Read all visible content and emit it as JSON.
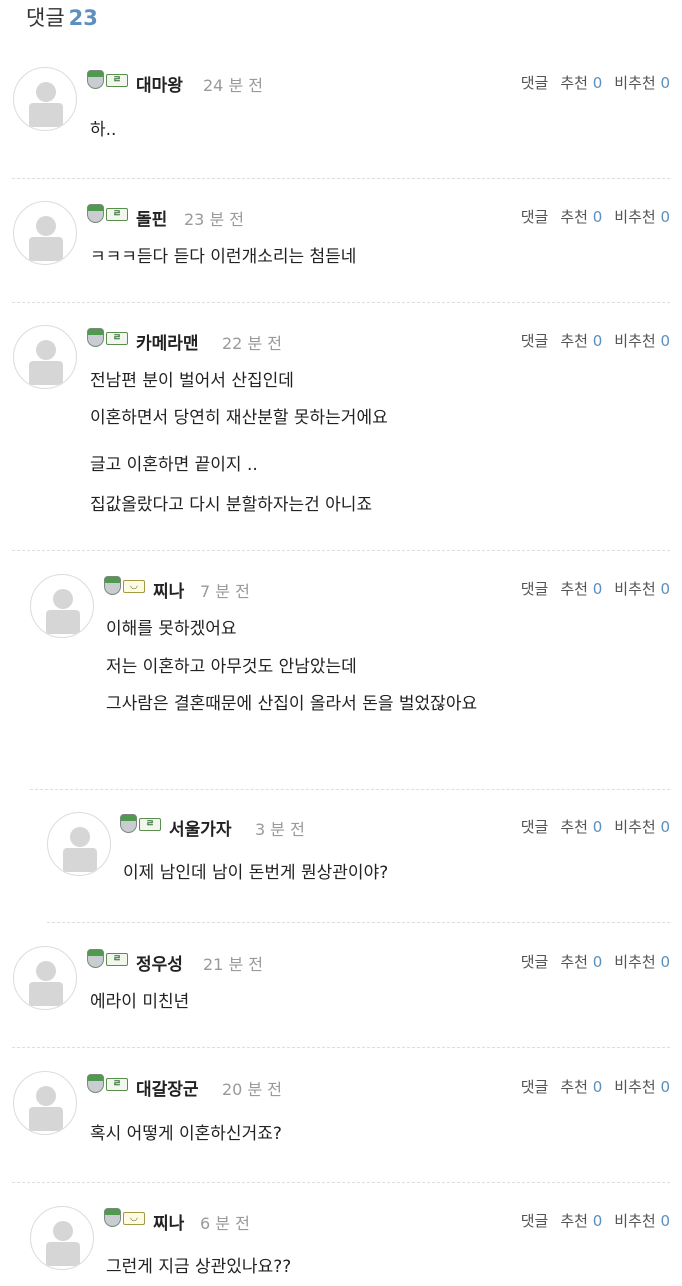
{
  "header": {
    "label": "댓글",
    "count": "23"
  },
  "labels": {
    "reply": "댓글",
    "up": "추천",
    "down": "비추천"
  },
  "comments": [
    {
      "nick": "대마왕",
      "time": "24 분 전",
      "up": "0",
      "down": "0",
      "lines": [
        "하.."
      ]
    },
    {
      "nick": "돌핀",
      "time": "23 분 전",
      "up": "0",
      "down": "0",
      "lines": [
        "ㅋㅋㅋ듣다 듣다 이런개소리는 첨듣네"
      ]
    },
    {
      "nick": "카메라맨",
      "time": "22 분 전",
      "up": "0",
      "down": "0",
      "lines": [
        "전남편 분이 벌어서 산집인데",
        "이혼하면서 당연히 재산분할 못하는거에요",
        "글고 이혼하면 끝이지 ..",
        "집값올랐다고 다시 분할하자는건 아니죠"
      ]
    },
    {
      "nick": "찌나",
      "time": "7 분 전",
      "up": "0",
      "down": "0",
      "lines": [
        "이해를 못하겠어요",
        "저는 이혼하고 아무것도 안남았는데",
        "그사람은 결혼때문에 산집이 올라서 돈을 벌었잖아요"
      ]
    },
    {
      "nick": "서울가자",
      "time": "3 분 전",
      "up": "0",
      "down": "0",
      "lines": [
        "이제 남인데 남이 돈번게 뭔상관이야?"
      ]
    },
    {
      "nick": "정우성",
      "time": "21 분 전",
      "up": "0",
      "down": "0",
      "lines": [
        "에라이 미친년"
      ]
    },
    {
      "nick": "대갈장군",
      "time": "20 분 전",
      "up": "0",
      "down": "0",
      "lines": [
        "혹시 어떻게 이혼하신거죠?"
      ]
    },
    {
      "nick": "찌나",
      "time": "6 분 전",
      "up": "0",
      "down": "0",
      "lines": [
        "그런게 지금 상관있나요??"
      ]
    }
  ]
}
